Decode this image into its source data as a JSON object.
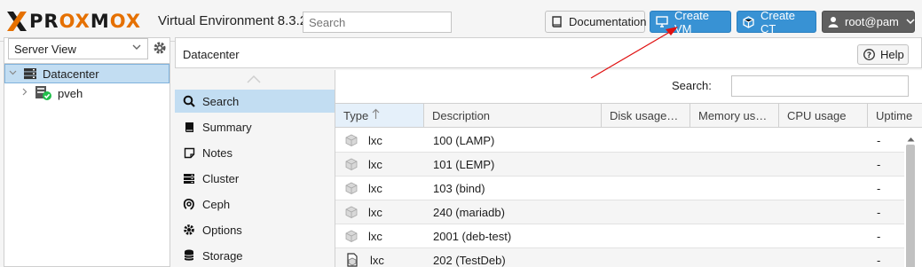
{
  "header": {
    "logo_text_left": "PR",
    "logo_text_ox": "OX",
    "logo_text_m": "M",
    "logo_text_ox2": "OX",
    "version_text": "Virtual Environment 8.3.2",
    "search_placeholder": "Search",
    "documentation_label": "Documentation",
    "create_vm_label": "Create VM",
    "create_ct_label": "Create CT",
    "user_label": "root@pam"
  },
  "sidebar": {
    "view_selected": "Server View",
    "tree": [
      {
        "label": "Datacenter",
        "icon": "server-rack-icon",
        "selected": true
      },
      {
        "label": "pveh",
        "icon": "node-online-icon",
        "selected": false
      }
    ]
  },
  "content": {
    "title": "Datacenter",
    "help_label": "Help"
  },
  "nav": {
    "items": [
      {
        "label": "Search",
        "icon": "search-icon",
        "active": true
      },
      {
        "label": "Summary",
        "icon": "book-icon",
        "active": false
      },
      {
        "label": "Notes",
        "icon": "notes-icon",
        "active": false
      },
      {
        "label": "Cluster",
        "icon": "server-icon",
        "active": false
      },
      {
        "label": "Ceph",
        "icon": "ceph-icon",
        "active": false
      },
      {
        "label": "Options",
        "icon": "gear-icon",
        "active": false
      },
      {
        "label": "Storage",
        "icon": "database-icon",
        "active": false
      }
    ]
  },
  "grid": {
    "search_label": "Search:",
    "search_value": "",
    "columns": [
      "Type",
      "Description",
      "Disk usage…",
      "Memory us…",
      "CPU usage",
      "Uptime"
    ],
    "rows": [
      {
        "type": "lxc",
        "description": "100 (LAMP)",
        "disk": "",
        "memory": "",
        "cpu": "",
        "uptime": "-"
      },
      {
        "type": "lxc",
        "description": "101 (LEMP)",
        "disk": "",
        "memory": "",
        "cpu": "",
        "uptime": "-"
      },
      {
        "type": "lxc",
        "description": "103 (bind)",
        "disk": "",
        "memory": "",
        "cpu": "",
        "uptime": "-"
      },
      {
        "type": "lxc",
        "description": "240 (mariadb)",
        "disk": "",
        "memory": "",
        "cpu": "",
        "uptime": "-"
      },
      {
        "type": "lxc",
        "description": "2001 (deb-test)",
        "disk": "",
        "memory": "",
        "cpu": "",
        "uptime": "-"
      },
      {
        "type": "lxc",
        "description": "202 (TestDeb)",
        "disk": "",
        "memory": "",
        "cpu": "",
        "uptime": "-"
      }
    ]
  },
  "colors": {
    "accent_blue": "#3892d4",
    "selection": "#c2ddf2",
    "logo_orange": "#e57000",
    "annotation_red": "#e01010"
  }
}
